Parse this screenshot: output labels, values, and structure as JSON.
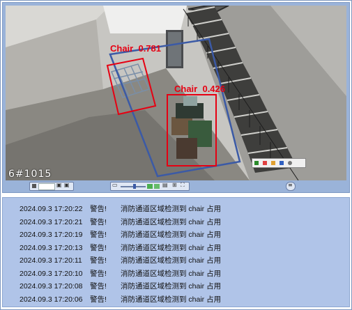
{
  "video": {
    "camera_id": "6#1015",
    "detections": [
      {
        "label": "Chair",
        "score": "0.781"
      },
      {
        "label": "Chair",
        "score": "0.426"
      }
    ],
    "controls": {
      "left_group_icons": [
        "record-icon",
        "snapshot-icon",
        "settings-icon"
      ],
      "center_group_icons": [
        "volume-slider",
        "grid-icon",
        "layout-icon",
        "fullscreen-icon"
      ],
      "right_icon": "menu-icon"
    }
  },
  "log": {
    "entries": [
      {
        "time": "2024.09.3 17:20:22",
        "level": "警告!",
        "message": "消防通道区域检测到 chair 占用"
      },
      {
        "time": "2024.09.3 17:20:21",
        "level": "警告!",
        "message": "消防通道区域检测到 chair 占用"
      },
      {
        "time": "2024.09.3 17:20:19",
        "level": "警告!",
        "message": "消防通道区域检测到 chair 占用"
      },
      {
        "time": "2024.09.3 17:20:13",
        "level": "警告!",
        "message": "消防通道区域检测到 chair 占用"
      },
      {
        "time": "2024.09.3 17:20:11",
        "level": "警告!",
        "message": "消防通道区域检测到 chair 占用"
      },
      {
        "time": "2024.09.3 17:20:10",
        "level": "警告!",
        "message": "消防通道区域检测到 chair 占用"
      },
      {
        "time": "2024.09.3 17:20:08",
        "level": "警告!",
        "message": "消防通道区域检测到 chair 占用"
      },
      {
        "time": "2024.09.3 17:20:06",
        "level": "警告!",
        "message": "消防通道区域检测到 chair 占用"
      }
    ]
  },
  "colors": {
    "detection_box": "#e60012",
    "zone_polygon": "#3b5aa6",
    "panel_bg": "#b0c4e8"
  }
}
